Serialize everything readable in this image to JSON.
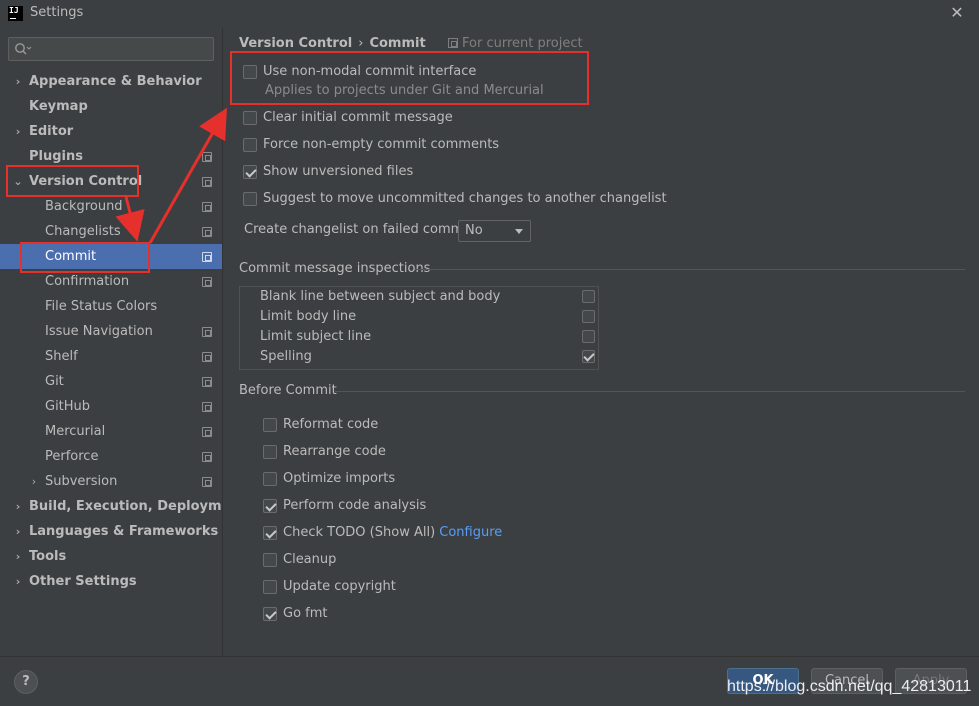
{
  "window": {
    "title": "Settings",
    "logo_text": "IJ",
    "close_glyph": "✕"
  },
  "search": {
    "placeholder": "",
    "value": ""
  },
  "sidebar": {
    "items": [
      {
        "label": "Appearance & Behavior",
        "bold": true,
        "arrow": "›",
        "indent": 0,
        "proj": false
      },
      {
        "label": "Keymap",
        "bold": true,
        "arrow": "",
        "indent": 0,
        "proj": false
      },
      {
        "label": "Editor",
        "bold": true,
        "arrow": "›",
        "indent": 0,
        "proj": false
      },
      {
        "label": "Plugins",
        "bold": true,
        "arrow": "",
        "indent": 0,
        "proj": true
      },
      {
        "label": "Version Control",
        "bold": true,
        "arrow": "⌄",
        "indent": 0,
        "proj": true
      },
      {
        "label": "Background",
        "bold": false,
        "arrow": "",
        "indent": 1,
        "proj": true
      },
      {
        "label": "Changelists",
        "bold": false,
        "arrow": "",
        "indent": 1,
        "proj": true
      },
      {
        "label": "Commit",
        "bold": false,
        "arrow": "",
        "indent": 1,
        "proj": true,
        "selected": true
      },
      {
        "label": "Confirmation",
        "bold": false,
        "arrow": "",
        "indent": 1,
        "proj": true
      },
      {
        "label": "File Status Colors",
        "bold": false,
        "arrow": "",
        "indent": 1,
        "proj": false
      },
      {
        "label": "Issue Navigation",
        "bold": false,
        "arrow": "",
        "indent": 1,
        "proj": true
      },
      {
        "label": "Shelf",
        "bold": false,
        "arrow": "",
        "indent": 1,
        "proj": true
      },
      {
        "label": "Git",
        "bold": false,
        "arrow": "",
        "indent": 1,
        "proj": true
      },
      {
        "label": "GitHub",
        "bold": false,
        "arrow": "",
        "indent": 1,
        "proj": true
      },
      {
        "label": "Mercurial",
        "bold": false,
        "arrow": "",
        "indent": 1,
        "proj": true
      },
      {
        "label": "Perforce",
        "bold": false,
        "arrow": "",
        "indent": 1,
        "proj": true
      },
      {
        "label": "Subversion",
        "bold": false,
        "arrow": "›",
        "indent": 1,
        "proj": true
      },
      {
        "label": "Build, Execution, Deployment",
        "bold": true,
        "arrow": "›",
        "indent": 0,
        "proj": false
      },
      {
        "label": "Languages & Frameworks",
        "bold": true,
        "arrow": "›",
        "indent": 0,
        "proj": false
      },
      {
        "label": "Tools",
        "bold": true,
        "arrow": "›",
        "indent": 0,
        "proj": false
      },
      {
        "label": "Other Settings",
        "bold": true,
        "arrow": "›",
        "indent": 0,
        "proj": false
      }
    ]
  },
  "main": {
    "breadcrumb": {
      "parent": "Version Control",
      "separator": "›",
      "current": "Commit"
    },
    "project_note": "For current project",
    "options": [
      {
        "label": "Use non-modal commit interface",
        "checked": false
      },
      {
        "label": "Clear initial commit message",
        "checked": false
      },
      {
        "label": "Force non-empty commit comments",
        "checked": false
      },
      {
        "label": "Show unversioned files",
        "checked": true
      },
      {
        "label": "Suggest to move uncommitted changes to another changelist",
        "checked": false
      }
    ],
    "non_modal_hint": "Applies to projects under Git and Mercurial",
    "changelist_failed": {
      "label": "Create changelist on failed commit:",
      "value": "No"
    },
    "inspections": {
      "title": "Commit message inspections",
      "items": [
        {
          "label": "Blank line between subject and body",
          "checked": false
        },
        {
          "label": "Limit body line",
          "checked": false
        },
        {
          "label": "Limit subject line",
          "checked": false
        },
        {
          "label": "Spelling",
          "checked": true
        }
      ]
    },
    "before_commit": {
      "title": "Before Commit",
      "items": [
        {
          "label": "Reformat code",
          "checked": false
        },
        {
          "label": "Rearrange code",
          "checked": false
        },
        {
          "label": "Optimize imports",
          "checked": false
        },
        {
          "label": "Perform code analysis",
          "checked": true
        },
        {
          "label": "Check TODO (Show All)",
          "checked": true,
          "link": "Configure"
        },
        {
          "label": "Cleanup",
          "checked": false
        },
        {
          "label": "Update copyright",
          "checked": false
        },
        {
          "label": "Go fmt",
          "checked": true
        }
      ]
    }
  },
  "footer": {
    "help": "?",
    "ok": "OK",
    "cancel": "Cancel",
    "apply": "Apply",
    "watermark": "https://blog.csdn.net/qq_42813011"
  },
  "colors": {
    "background": "#3c3f41",
    "selection": "#4b6eaf",
    "annotation": "#e5302c",
    "link": "#589df6",
    "primary_button": "#365880"
  }
}
